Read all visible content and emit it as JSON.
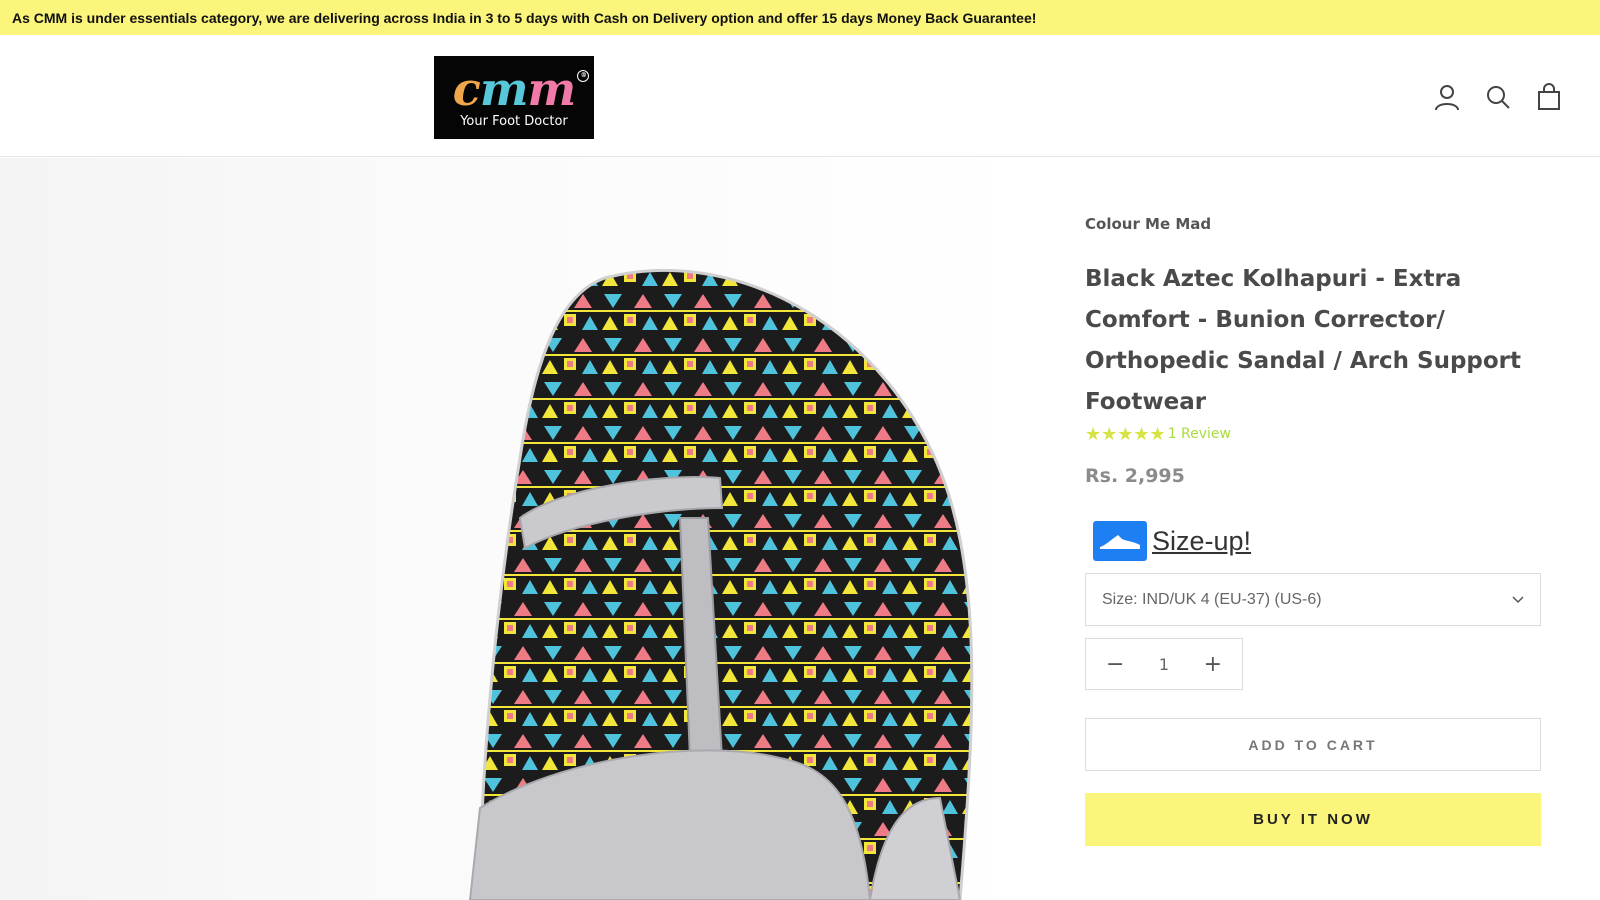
{
  "announcement": {
    "text": "As CMM is under essentials category, we are delivering across India in 3 to 5 days with Cash on Delivery option and offer 15 days Money Back Guarantee!"
  },
  "header": {
    "logo": {
      "mark": "CMM",
      "tagline": "Your Foot Doctor"
    },
    "icons": [
      "account-icon",
      "search-icon",
      "cart-icon"
    ]
  },
  "product": {
    "vendor": "Colour Me Mad",
    "title": "Black Aztec Kolhapuri - Extra Comfort - Bunion Corrector/ Orthopedic Sandal / Arch Support Footwear",
    "rating": {
      "stars": 5,
      "review_text": "1 Review"
    },
    "price": "Rs. 2,995",
    "sizeup_label": "Size-up!",
    "size_select": {
      "selected": "Size: IND/UK 4 (EU-37) (US-6)"
    },
    "quantity": "1",
    "add_to_cart": "ADD TO CART",
    "buy_now": "BUY IT NOW"
  },
  "colors": {
    "announcement_bg": "#fbf57c",
    "buy_button_bg": "#fbf57c",
    "star_color": "#d7e341",
    "review_link": "#a8dd3e",
    "sizeup_icon_bg": "#1e7ff2"
  }
}
